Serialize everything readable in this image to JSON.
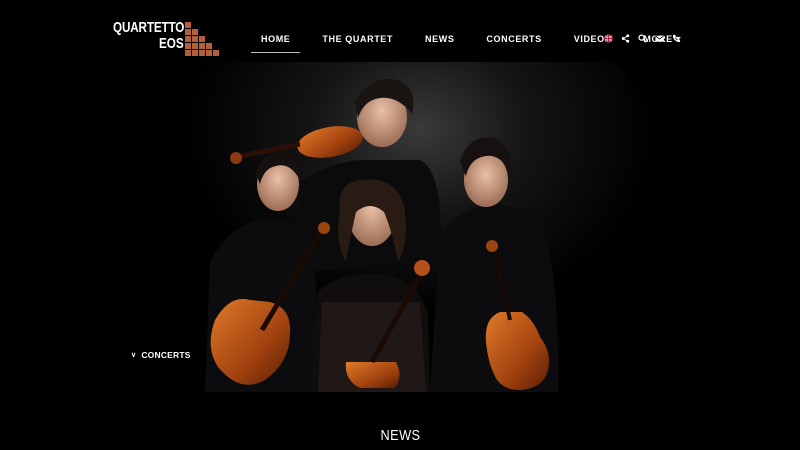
{
  "logo": {
    "line1": "QUARTETTO",
    "line2": "EOS",
    "blocks_color": "#b4603a"
  },
  "nav": {
    "items": [
      {
        "label": "HOME",
        "active": true
      },
      {
        "label": "THE QUARTET",
        "active": false
      },
      {
        "label": "NEWS",
        "active": false
      },
      {
        "label": "CONCERTS",
        "active": false
      },
      {
        "label": "VIDEOS",
        "active": false
      },
      {
        "label": "MORE",
        "active": false,
        "dropdown": true
      }
    ],
    "icons": [
      "uk-flag-icon",
      "share-icon",
      "search-icon",
      "envelope-icon",
      "phone-icon"
    ]
  },
  "hero": {
    "image": "string-quartet-photo"
  },
  "concerts_link": {
    "label": "CONCERTS",
    "icon": "chevron-down-icon"
  },
  "section": {
    "heading": "NEWS"
  },
  "colors": {
    "background": "#000000",
    "text": "#ffffff",
    "accent": "#b4603a",
    "active_underline": "#bdbdbd"
  }
}
